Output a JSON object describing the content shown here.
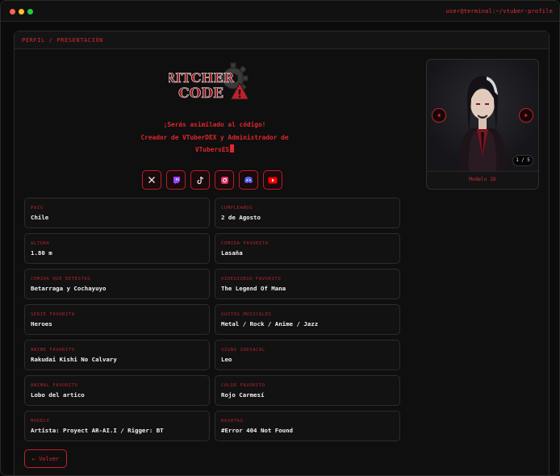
{
  "terminal": {
    "path": "user@terminal:~/vtuber-profile"
  },
  "panel": {
    "title": "PERFIL / PRESENTACIÓN"
  },
  "logo": {
    "text_line1": "RITCHER",
    "text_line2": "CODE",
    "mark": "!"
  },
  "tagline": {
    "line1": "¡Serás asimilado al código!",
    "line2": "Creador de VTuberDEX y Administrador de",
    "line3": "VTubersES"
  },
  "socials": [
    {
      "name": "x-icon"
    },
    {
      "name": "twitch-icon"
    },
    {
      "name": "tiktok-icon"
    },
    {
      "name": "instagram-icon"
    },
    {
      "name": "discord-icon"
    },
    {
      "name": "youtube-icon"
    }
  ],
  "fields": [
    {
      "label": "PAÍS",
      "value": "Chile"
    },
    {
      "label": "CUMPLEAÑOS",
      "value": "2 de Agosto"
    },
    {
      "label": "ALTURA",
      "value": "1.80 m"
    },
    {
      "label": "COMIDA FAVORITA",
      "value": "Lasaña"
    },
    {
      "label": "COMIDA QUE DETESTAS",
      "value": "Betarraga y Cochayuyo"
    },
    {
      "label": "VIDEOJUEGO FAVORITO",
      "value": "The Legend Of Mana"
    },
    {
      "label": "SERIE FAVORITA",
      "value": "Heroes"
    },
    {
      "label": "GUSTOS MUSICALES",
      "value": "Metal / Rock / Anime / Jazz"
    },
    {
      "label": "ANIME FAVORITO",
      "value": "Rakudai Kishi No Calvary"
    },
    {
      "label": "SIGNO ZODIACAL",
      "value": "Leo"
    },
    {
      "label": "ANIMAL FAVORITO",
      "value": "Lobo del artico"
    },
    {
      "label": "COLOR FAVORITO",
      "value": "Rojo Carmesí"
    },
    {
      "label": "MODELO",
      "value": "Artista: Proyect AR-AI.I / Rigger: BT"
    },
    {
      "label": "HASHTAG",
      "value": "#Error 404 Not Found"
    }
  ],
  "back_button": {
    "label": "← Volver"
  },
  "model": {
    "counter": "1 / 5",
    "caption": "Modelo 2D"
  },
  "colors": {
    "accent": "#e0262f",
    "background": "#0b0b0b",
    "card": "#121212"
  }
}
